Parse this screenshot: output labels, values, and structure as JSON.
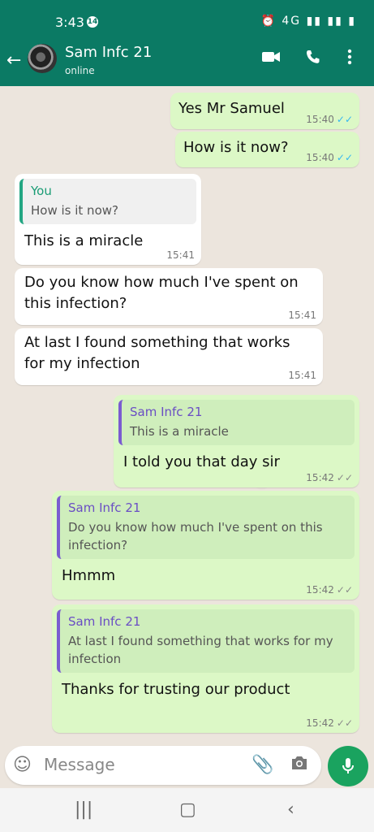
{
  "status_bar": {
    "time": "3:43",
    "notification_count": "14",
    "system_icons": "⏰ 4G ▮▮ ▮▮ ▮"
  },
  "header": {
    "contact_name": "Sam Infc 21",
    "contact_status": "online",
    "icons": [
      "back-arrow-icon",
      "video-call-icon",
      "voice-call-icon",
      "more-options-icon"
    ]
  },
  "messages": [
    {
      "direction": "out",
      "text": "Yes Mr Samuel",
      "time": "15:40",
      "status": "read"
    },
    {
      "direction": "out",
      "text": "How is it now?",
      "time": "15:40",
      "status": "read"
    },
    {
      "direction": "in",
      "quote_author": "You",
      "quote_text": "How is it now?",
      "text": "This is a miracle",
      "time": "15:41"
    },
    {
      "direction": "in",
      "text": "Do you know how much I've spent on this infection?",
      "time": "15:41"
    },
    {
      "direction": "in",
      "text": "At last I found something that works for my infection",
      "time": "15:41"
    },
    {
      "direction": "out",
      "quote_author": "Sam Infc 21",
      "quote_text": "This is a miracle",
      "text": "I told you that day sir",
      "time": "15:42",
      "status": "delivered"
    },
    {
      "direction": "out",
      "quote_author": "Sam Infc 21",
      "quote_text": "Do you know how much I've spent on this infection?",
      "text": "Hmmm",
      "time": "15:42",
      "status": "delivered"
    },
    {
      "direction": "out",
      "quote_author": "Sam Infc 21",
      "quote_text": "At last I found something that works for my infection",
      "text": "Thanks for trusting our product",
      "time": "15:42",
      "status": "delivered"
    }
  ],
  "composer": {
    "placeholder": "Message"
  },
  "colors": {
    "header": "#0b7a64",
    "outgoing_bubble": "#dcf8c6",
    "incoming_bubble": "#ffffff",
    "read_ticks": "#34b7f1",
    "mic_button": "#1aa35f"
  }
}
